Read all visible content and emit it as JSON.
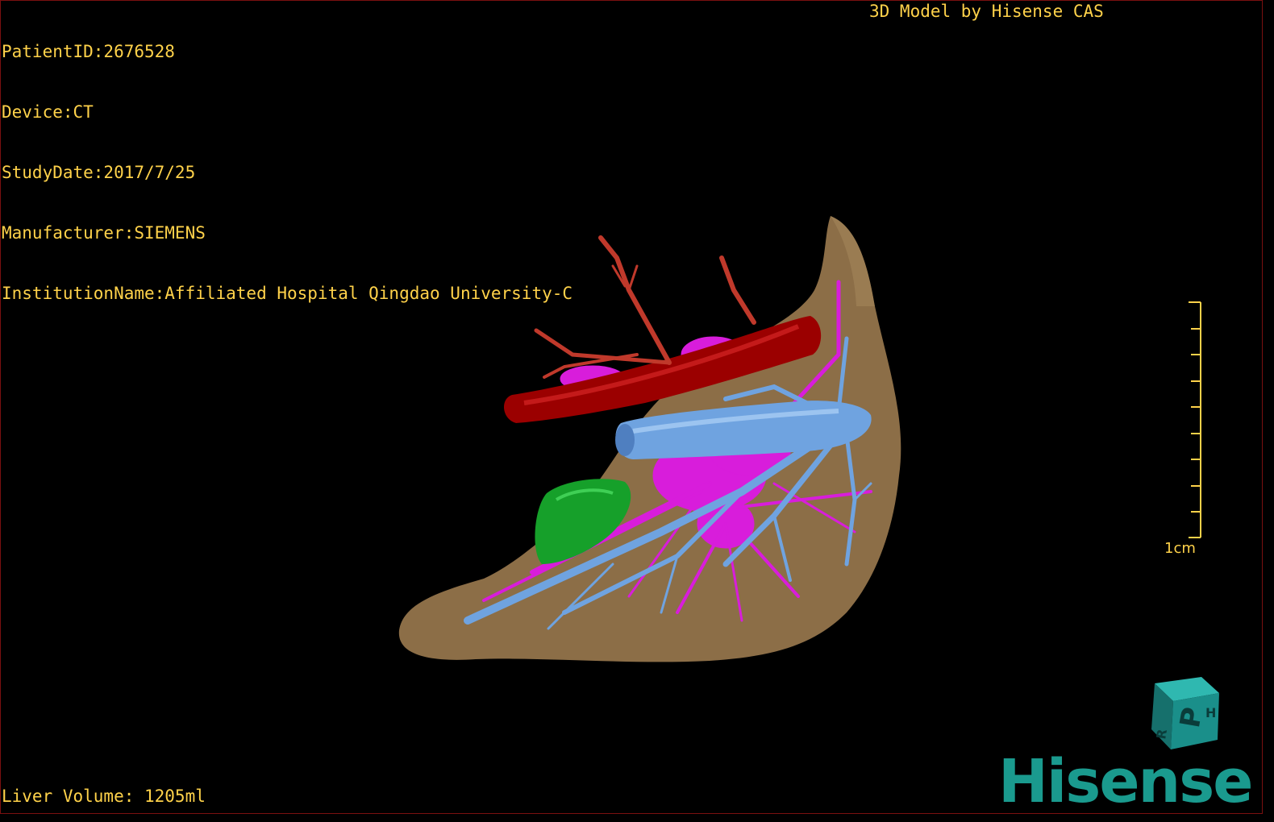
{
  "patient_info": {
    "patient_id": "PatientID:2676528",
    "device": "Device:CT",
    "study_date": "StudyDate:2017/7/25",
    "manufacturer": "Manufacturer:SIEMENS",
    "institution": "InstitutionName:Affiliated Hospital Qingdao University-C"
  },
  "credit": "3D Model by Hisense CAS",
  "liver_volume": "Liver Volume: 1205ml",
  "scale_bar": {
    "label": "1cm",
    "color": "#ffd24a"
  },
  "orientation_cube": {
    "face_front": "P",
    "face_side": "H",
    "face_bottom": "R",
    "color": "#1a8f8a"
  },
  "brand": {
    "name": "Hisense",
    "color": "#1a9a8e"
  },
  "model_colors": {
    "liver": "#8c6e47",
    "hepatic_artery": "#c0392b",
    "vena_cava": "#9b0000",
    "portal_vein": "#d81ddb",
    "hepatic_vein": "#6fa3e0",
    "lesion": "#16a02a"
  },
  "text_color": "#ffd24a"
}
